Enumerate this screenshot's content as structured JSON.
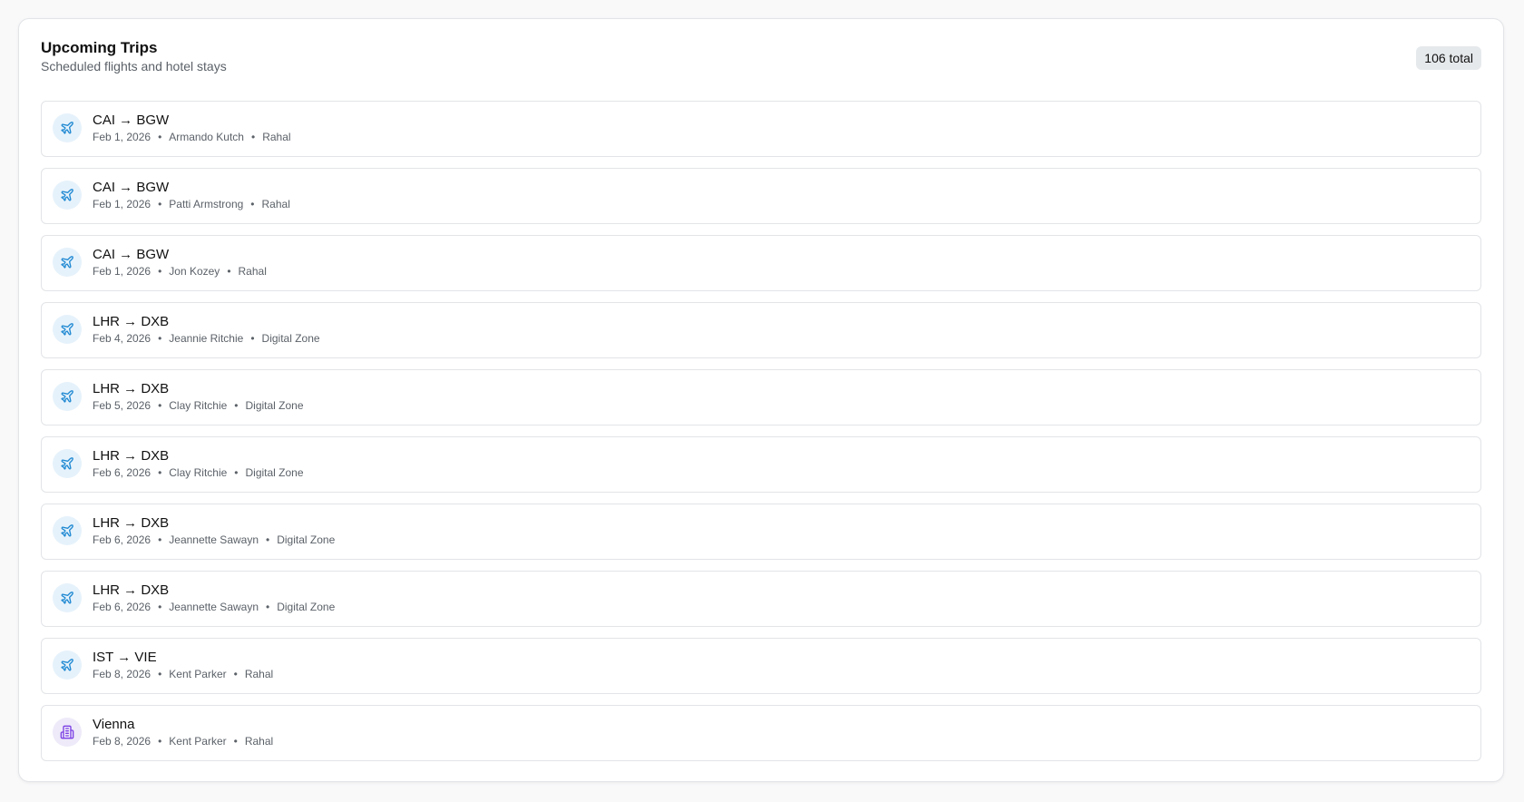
{
  "header": {
    "title": "Upcoming Trips",
    "subtitle": "Scheduled flights and hotel stays",
    "total": "106 total"
  },
  "colors": {
    "flight_icon": "#1e88d2",
    "flight_icon_bg": "#e6f2fb",
    "hotel_icon": "#7b3fe4",
    "hotel_icon_bg": "#eeeaf9"
  },
  "trips": [
    {
      "type": "flight",
      "icon": "plane-icon",
      "title": "CAI → BGW",
      "date": "Feb 1, 2026",
      "traveler": "Armando Kutch",
      "company": "Rahal"
    },
    {
      "type": "flight",
      "icon": "plane-icon",
      "title": "CAI → BGW",
      "date": "Feb 1, 2026",
      "traveler": "Patti Armstrong",
      "company": "Rahal"
    },
    {
      "type": "flight",
      "icon": "plane-icon",
      "title": "CAI → BGW",
      "date": "Feb 1, 2026",
      "traveler": "Jon Kozey",
      "company": "Rahal"
    },
    {
      "type": "flight",
      "icon": "plane-icon",
      "title": "LHR → DXB",
      "date": "Feb 4, 2026",
      "traveler": "Jeannie Ritchie",
      "company": "Digital Zone"
    },
    {
      "type": "flight",
      "icon": "plane-icon",
      "title": "LHR → DXB",
      "date": "Feb 5, 2026",
      "traveler": "Clay Ritchie",
      "company": "Digital Zone"
    },
    {
      "type": "flight",
      "icon": "plane-icon",
      "title": "LHR → DXB",
      "date": "Feb 6, 2026",
      "traveler": "Clay Ritchie",
      "company": "Digital Zone"
    },
    {
      "type": "flight",
      "icon": "plane-icon",
      "title": "LHR → DXB",
      "date": "Feb 6, 2026",
      "traveler": "Jeannette Sawayn",
      "company": "Digital Zone"
    },
    {
      "type": "flight",
      "icon": "plane-icon",
      "title": "LHR → DXB",
      "date": "Feb 6, 2026",
      "traveler": "Jeannette Sawayn",
      "company": "Digital Zone"
    },
    {
      "type": "flight",
      "icon": "plane-icon",
      "title": "IST → VIE",
      "date": "Feb 8, 2026",
      "traveler": "Kent Parker",
      "company": "Rahal"
    },
    {
      "type": "hotel",
      "icon": "hotel-icon",
      "title": "Vienna",
      "date": "Feb 8, 2026",
      "traveler": "Kent Parker",
      "company": "Rahal"
    }
  ]
}
